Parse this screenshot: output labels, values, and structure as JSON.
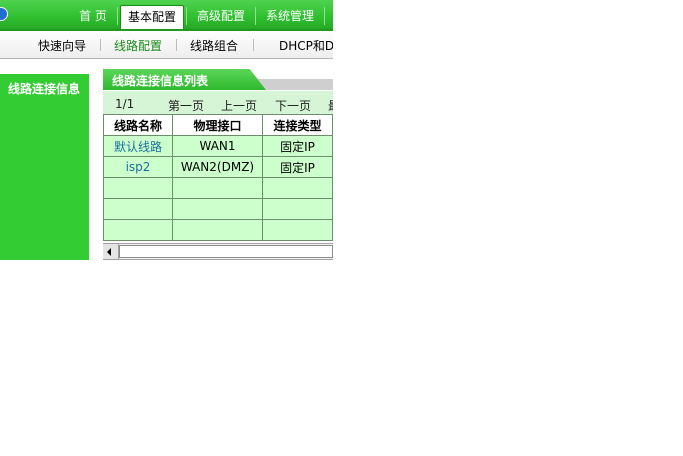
{
  "top_nav": {
    "tabs": [
      {
        "label": "首 页",
        "active": false
      },
      {
        "label": "基本配置",
        "active": true
      },
      {
        "label": "高级配置",
        "active": false
      },
      {
        "label": "系统管理",
        "active": false
      }
    ]
  },
  "sub_nav": {
    "items": [
      {
        "label": "快速向导",
        "active": false
      },
      {
        "label": "线路配置",
        "active": true
      },
      {
        "label": "线路组合",
        "active": false
      },
      {
        "label": "DHCP和D",
        "active": false
      }
    ]
  },
  "sidebar": {
    "title": "线路连接信息"
  },
  "panel": {
    "title": "线路连接信息列表"
  },
  "pager": {
    "count": "1/1",
    "first": "第一页",
    "prev": "上一页",
    "next": "下一页",
    "last_fragment": "最"
  },
  "table": {
    "headers": [
      "线路名称",
      "物理接口",
      "连接类型"
    ],
    "rows": [
      [
        "默认线路",
        "WAN1",
        "固定IP"
      ],
      [
        "isp2",
        "WAN2(DMZ)",
        "固定IP"
      ],
      [
        "",
        "",
        ""
      ],
      [
        "",
        "",
        ""
      ],
      [
        "",
        "",
        ""
      ]
    ]
  },
  "colors": {
    "brand_green": "#33cc33",
    "row_fill": "#ccffcc",
    "link_blue": "#1a6fa0",
    "active_green": "#1a8a1a"
  }
}
